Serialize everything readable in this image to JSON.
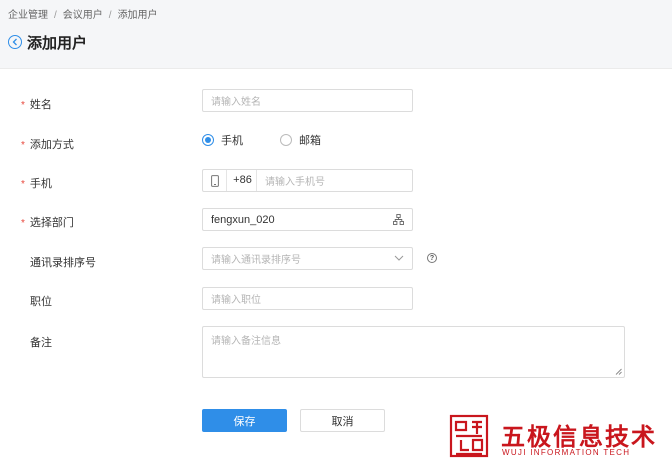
{
  "breadcrumb": [
    "企业管理",
    "会议用户",
    "添加用户"
  ],
  "page_title": "添加用户",
  "form": {
    "name": {
      "label": "姓名",
      "placeholder": "请输入姓名"
    },
    "add_method": {
      "label": "添加方式",
      "options": [
        "手机",
        "邮箱"
      ],
      "selected": "手机"
    },
    "phone": {
      "label": "手机",
      "country_code": "+86",
      "placeholder": "请输入手机号"
    },
    "department": {
      "label": "选择部门",
      "value": "fengxun_020"
    },
    "sort_no": {
      "label": "通讯录排序号",
      "placeholder": "请输入通讯录排序号"
    },
    "position": {
      "label": "职位",
      "placeholder": "请输入职位"
    },
    "remark": {
      "label": "备注",
      "placeholder": "请输入备注信息"
    }
  },
  "buttons": {
    "save": "保存",
    "cancel": "取消"
  },
  "watermark": {
    "cn": "五极信息技术",
    "en": "WUJI INFORMATION TECH"
  },
  "colors": {
    "primary": "#2f8ee8",
    "required": "#e8473c",
    "watermark": "#c9161d"
  }
}
